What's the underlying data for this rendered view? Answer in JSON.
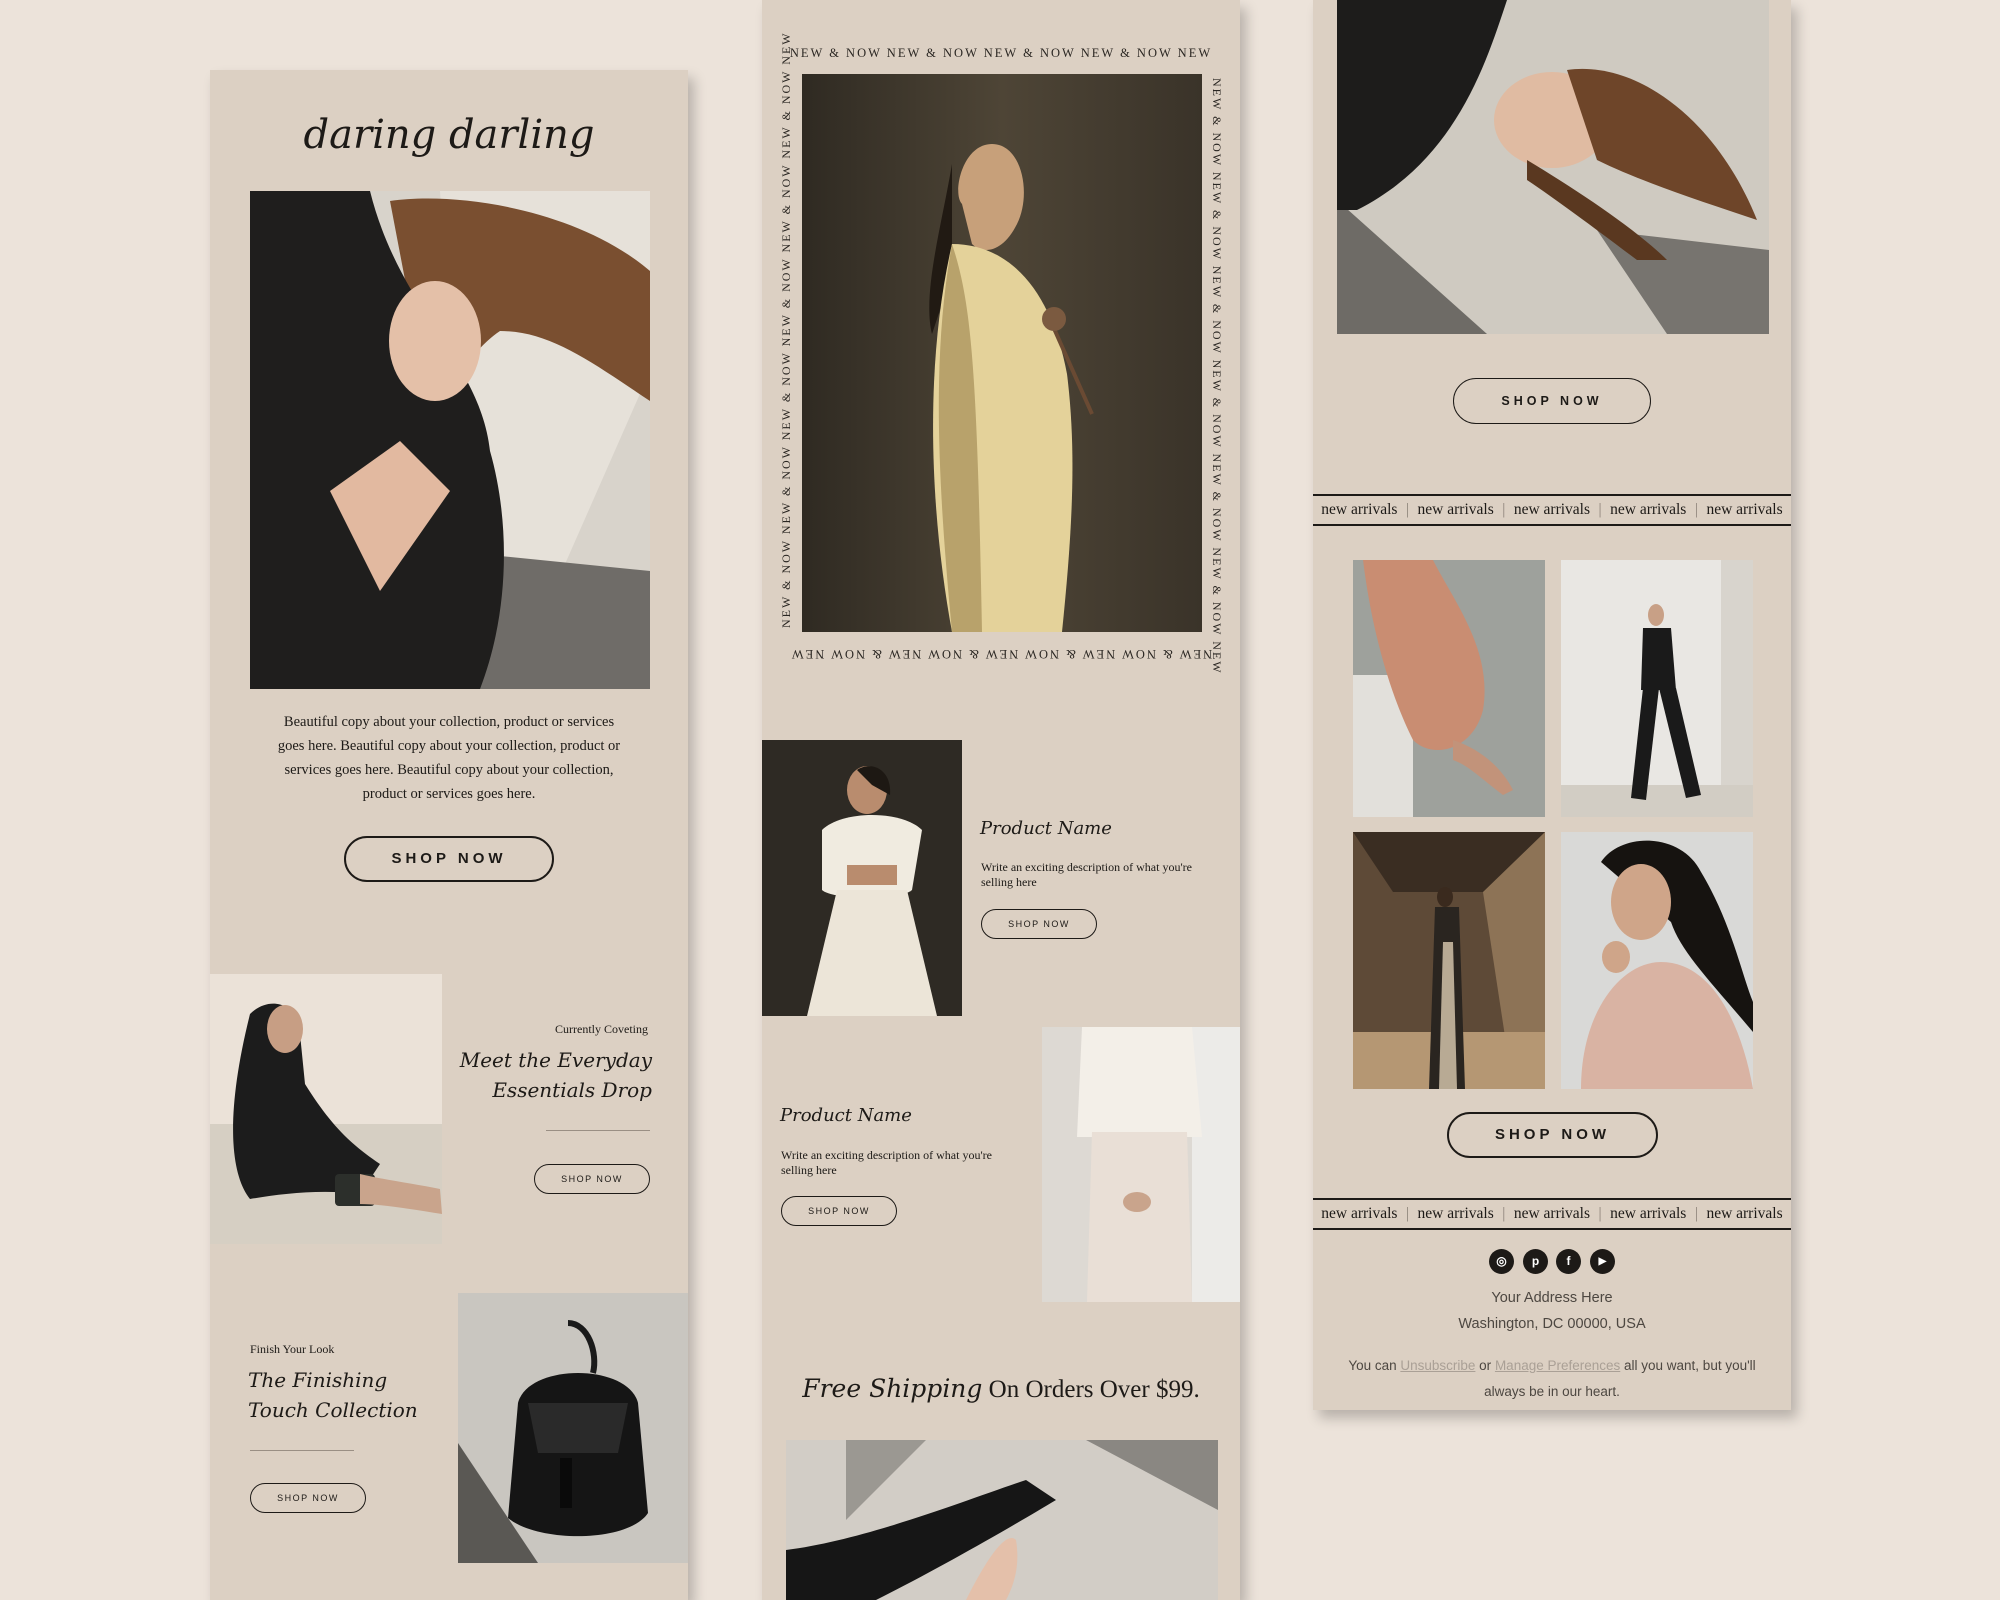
{
  "brand": {
    "script_title": "daring darling"
  },
  "colors": {
    "page_bg": "#ece3da",
    "panel_bg": "#dcd0c3",
    "ink": "#1d1a17",
    "muted_link": "#aaa096"
  },
  "column1": {
    "intro_copy": "Beautiful copy about your collection, product or services goes here. Beautiful copy about your collection, product or services goes here. Beautiful copy about your collection, product or services goes here.",
    "shop_now": "SHOP NOW",
    "feature1": {
      "eyebrow": "Currently Coveting",
      "title_line1": "Meet the Everyday",
      "title_line2": "Essentials Drop",
      "cta": "SHOP NOW"
    },
    "feature2": {
      "eyebrow": "Finish Your Look",
      "title_line1": "The Finishing",
      "title_line2": "Touch Collection",
      "cta": "SHOP NOW"
    }
  },
  "column2": {
    "ticker_text": "NEW & NOW  NEW & NOW  NEW & NOW  NEW & NOW  NEW",
    "ticker_side": "NEW & NOW NEW & NOW NEW & NOW NEW & NOW NEW & NOW NEW & NOW NEW",
    "product1": {
      "name": "Product Name",
      "desc_line1": "Write an exciting description of what you're",
      "desc_line2": "selling here",
      "cta": "SHOP NOW"
    },
    "product2": {
      "name": "Product Name",
      "desc_line1": "Write an exciting description of what you're",
      "desc_line2": "selling here",
      "cta": "SHOP NOW"
    },
    "shipping_script": "Free Shipping",
    "shipping_rest": " On Orders Over $99."
  },
  "column3": {
    "shop_now_top": "SHOP NOW",
    "banner_items": [
      "new arrivals",
      "new arrivals",
      "new arrivals",
      "new arrivals",
      "new arrivals"
    ],
    "shop_now_bottom": "SHOP NOW",
    "socials": [
      {
        "icon": "instagram-icon",
        "glyph": "◎"
      },
      {
        "icon": "pinterest-icon",
        "glyph": "p"
      },
      {
        "icon": "facebook-icon",
        "glyph": "f"
      },
      {
        "icon": "youtube-icon",
        "glyph": "▶"
      }
    ],
    "address_line1": "Your Address Here",
    "address_line2": "Washington, DC 00000, USA",
    "footer_prefix": "You can ",
    "unsubscribe": "Unsubscribe",
    "footer_or": " or ",
    "manage_preferences": "Manage Preferences",
    "footer_suffix": " all you want, but you'll",
    "footer_line2": "always be in our heart."
  }
}
